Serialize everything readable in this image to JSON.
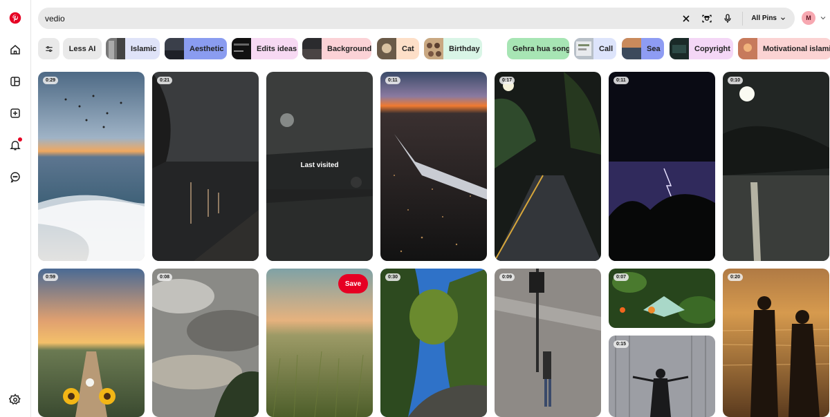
{
  "search": {
    "value": "vedio",
    "filter_label": "All Pins"
  },
  "account": {
    "initial": "M"
  },
  "chips": [
    {
      "label": "Less AI",
      "color": "#e9e9e9"
    },
    {
      "label": "Islamic",
      "color": "#dfe3f8"
    },
    {
      "label": "Aesthetic",
      "color": "#8a9cf0"
    },
    {
      "label": "Edits ideas",
      "color": "#f7d9f3"
    },
    {
      "label": "Background",
      "color": "#fbd2d6"
    },
    {
      "label": "Cat",
      "color": "#fddfc8"
    },
    {
      "label": "Birthday",
      "color": "#d9f5e6"
    },
    {
      "label": "Gehra hua song",
      "color": "#a7e5b4"
    },
    {
      "label": "Call",
      "color": "#dde4fb"
    },
    {
      "label": "Sea",
      "color": "#8e9cf3"
    },
    {
      "label": "Copyright",
      "color": "#f4d7f6"
    },
    {
      "label": "Motivational islamic",
      "color": "#fbd3d3"
    }
  ],
  "pins": [
    {
      "duration": "0:29",
      "scene": "sea-birds"
    },
    {
      "duration": "0:21",
      "scene": "rainy-street"
    },
    {
      "duration": "",
      "scene": "foggy-rain",
      "overlay": "Last visited"
    },
    {
      "duration": "0:11",
      "scene": "plane-city"
    },
    {
      "duration": "0:17",
      "scene": "night-road"
    },
    {
      "duration": "0:11",
      "scene": "lightning"
    },
    {
      "duration": "0:10",
      "scene": "moon-water"
    },
    {
      "duration": "0:59",
      "scene": "sunflower-sunset"
    },
    {
      "duration": "0:08",
      "scene": "clouds"
    },
    {
      "duration": "",
      "scene": "wheat-field",
      "save_label": "Save"
    },
    {
      "duration": "0:30",
      "scene": "forest-path"
    },
    {
      "duration": "0:09",
      "scene": "street-walk"
    },
    {
      "duration": "0:07",
      "scene": "book-forest"
    },
    {
      "duration": "0:15",
      "scene": "silhouette-woman"
    },
    {
      "duration": "0:20",
      "scene": "couple-sunset"
    }
  ],
  "colors": {
    "brand": "#e60023"
  }
}
